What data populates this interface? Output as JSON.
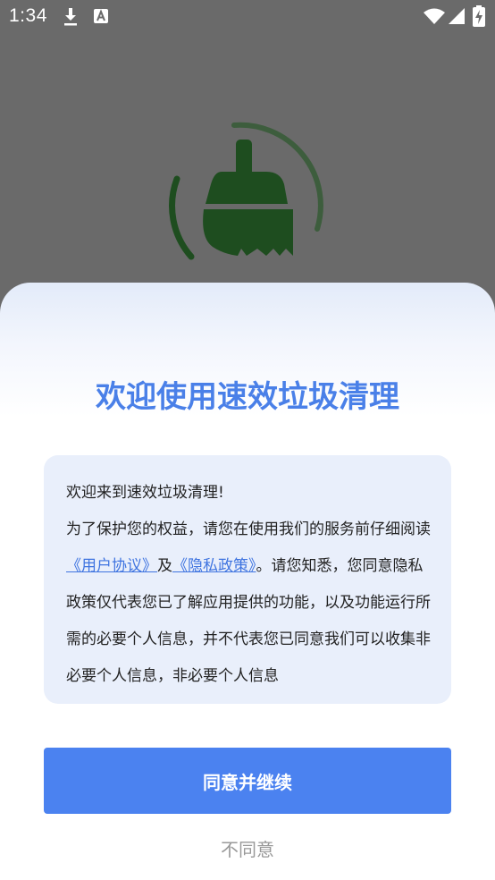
{
  "status_bar": {
    "time": "1:34",
    "icons": [
      "download-icon",
      "autofill-a-icon",
      "wifi-icon",
      "signal-icon",
      "battery-charging-icon"
    ]
  },
  "splash": {
    "icon": "broom-icon",
    "accent_color": "#1e4d1f"
  },
  "dialog": {
    "title": "欢迎使用速效垃圾清理",
    "body": {
      "greeting": "欢迎来到速效垃圾清理!",
      "text_before": "为了保护您的权益，请您在使用我们的服务前仔细阅读",
      "user_agreement_link": "《用户协议》",
      "and": "及",
      "privacy_policy_link": "《隐私政策》",
      "text_after": "。请您知悉，您同意隐私政策仅代表您已了解应用提供的功能，以及功能运行所需的必要个人信息，并不代表您已同意我们可以收集非必要个人信息，非必要个人信息"
    },
    "agree_button": "同意并继续",
    "disagree_button": "不同意"
  },
  "colors": {
    "title": "#4a80e8",
    "link": "#3f74e0",
    "primary_button": "#4b82f0",
    "content_background": "#e9effb",
    "overlay": "#6a6a6a"
  }
}
